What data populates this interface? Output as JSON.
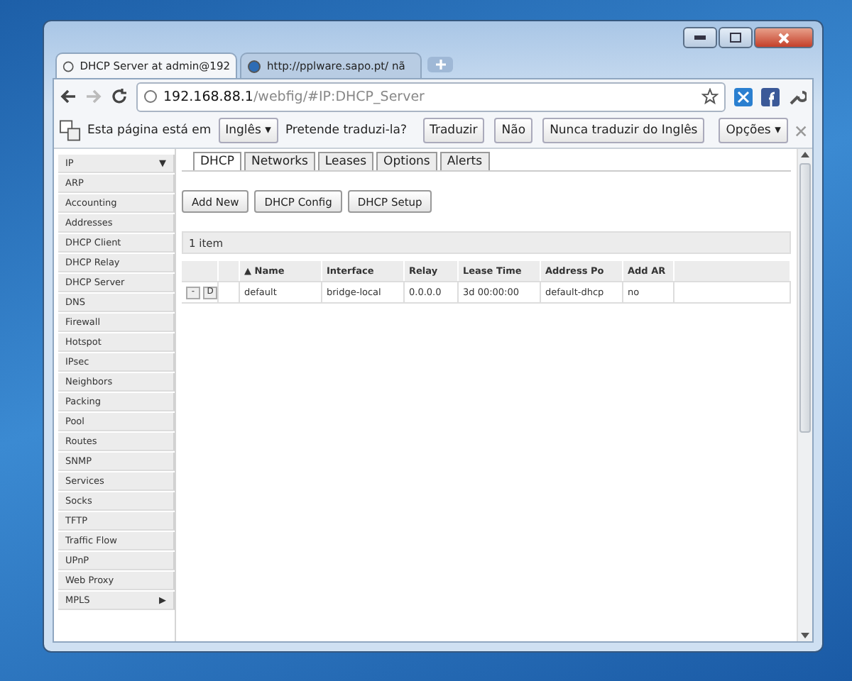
{
  "browser_tabs": [
    {
      "title": "DHCP Server at admin@192",
      "selected": true
    },
    {
      "title": "http://pplware.sapo.pt/ nã",
      "selected": false
    }
  ],
  "address_bar": {
    "host": "192.168.88.1",
    "path": "/webfig/#IP:DHCP_Server"
  },
  "translate_bar": {
    "message": "Esta página está em",
    "language": "Inglês",
    "dropdown_arrow": "▾",
    "question": "Pretende traduzi-la?",
    "buttons": [
      "Traduzir",
      "Não",
      "Nunca traduzir do Inglês"
    ],
    "options": "Opções"
  },
  "sidebar": {
    "items": [
      {
        "label": "IP",
        "arrow": "▼"
      },
      {
        "label": "ARP"
      },
      {
        "label": "Accounting"
      },
      {
        "label": "Addresses"
      },
      {
        "label": "DHCP Client"
      },
      {
        "label": "DHCP Relay"
      },
      {
        "label": "DHCP Server"
      },
      {
        "label": "DNS"
      },
      {
        "label": "Firewall"
      },
      {
        "label": "Hotspot"
      },
      {
        "label": "IPsec"
      },
      {
        "label": "Neighbors"
      },
      {
        "label": "Packing"
      },
      {
        "label": "Pool"
      },
      {
        "label": "Routes"
      },
      {
        "label": "SNMP"
      },
      {
        "label": "Services"
      },
      {
        "label": "Socks"
      },
      {
        "label": "TFTP"
      },
      {
        "label": "Traffic Flow"
      },
      {
        "label": "UPnP"
      },
      {
        "label": "Web Proxy"
      },
      {
        "label": "MPLS",
        "arrow": "▶"
      }
    ]
  },
  "tabs": [
    {
      "label": "DHCP",
      "selected": true
    },
    {
      "label": "Networks",
      "selected": false
    },
    {
      "label": "Leases",
      "selected": false
    },
    {
      "label": "Options",
      "selected": false
    },
    {
      "label": "Alerts",
      "selected": false
    }
  ],
  "actions": [
    "Add New",
    "DHCP Config",
    "DHCP Setup"
  ],
  "table": {
    "count": "1 item",
    "columns": [
      "▲ Name",
      "Interface",
      "Relay",
      "Lease Time",
      "Address Po",
      "Add AR"
    ],
    "rows": [
      {
        "controls": [
          "-",
          "D"
        ],
        "cells": [
          "default",
          "bridge-local",
          "0.0.0.0",
          "3d 00:00:00",
          "default-dhcp",
          "no"
        ]
      }
    ]
  }
}
